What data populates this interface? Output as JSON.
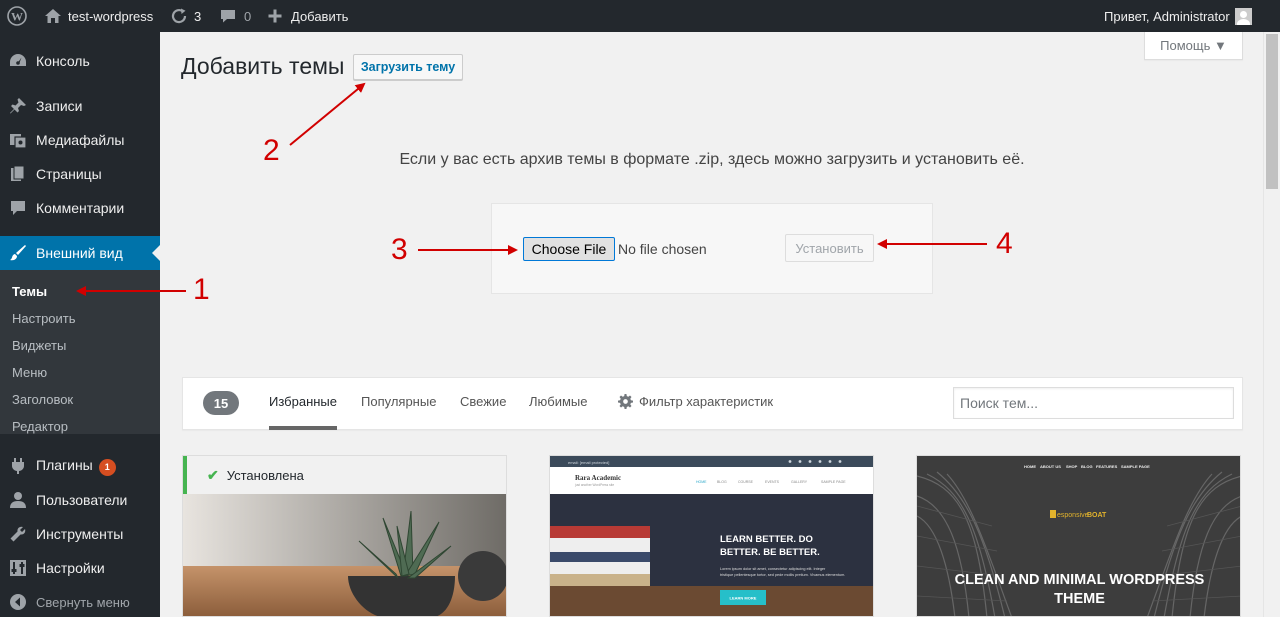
{
  "adminbar": {
    "site_name": "test-wordpress",
    "updates_count": "3",
    "comments_count": "0",
    "new_label": "Добавить",
    "greeting": "Привет, Administrator"
  },
  "sidebar": {
    "items": [
      {
        "label": "Консоль",
        "icon": "dashboard-icon"
      },
      {
        "label": "Записи",
        "icon": "pushpin-icon"
      },
      {
        "label": "Медиафайлы",
        "icon": "media-icon"
      },
      {
        "label": "Страницы",
        "icon": "page-icon"
      },
      {
        "label": "Комментарии",
        "icon": "comment-icon"
      },
      {
        "label": "Внешний вид",
        "icon": "brush-icon"
      },
      {
        "label": "Плагины",
        "icon": "plugin-icon",
        "badge": "1"
      },
      {
        "label": "Пользователи",
        "icon": "users-icon"
      },
      {
        "label": "Инструменты",
        "icon": "wrench-icon"
      },
      {
        "label": "Настройки",
        "icon": "settings-icon"
      },
      {
        "label": "Свернуть меню",
        "icon": "collapse-icon"
      }
    ],
    "submenu": [
      "Темы",
      "Настроить",
      "Виджеты",
      "Меню",
      "Заголовок",
      "Редактор"
    ]
  },
  "header": {
    "help_label": "Помощь ▼",
    "title": "Добавить темы",
    "upload_button": "Загрузить тему"
  },
  "upload": {
    "description": "Если у вас есть архив темы в формате .zip, здесь можно загрузить и установить её.",
    "file_button": "Choose File",
    "file_status": "No file chosen",
    "install_button": "Установить"
  },
  "filter": {
    "count": "15",
    "tabs": [
      "Избранные",
      "Популярные",
      "Свежие",
      "Любимые"
    ],
    "feature_filter": "Фильтр характеристик",
    "search_placeholder": "Поиск тем..."
  },
  "themes": [
    {
      "installed_label": "Установлена"
    },
    {
      "email": "email: [email protected]",
      "name": "Rara Academic",
      "tagline": "just another WordPress site",
      "nav": [
        "HOME",
        "BLOG",
        "COURSE",
        "EVENTS",
        "GALLERY",
        "SAMPLE PAGE"
      ],
      "headline_1": "LEARN BETTER. DO",
      "headline_2": "BETTER. BE BETTER.",
      "body": "Lorem ipsum dolor sit amet, consectetur adipiscing elit. Integer tristique pellentesque tortor, sed pede mollis pretium. Vivamus elementum.",
      "cta": "LEARN MORE"
    },
    {
      "nav": [
        "HOME",
        "ABOUT US",
        "SHOP",
        "BLOG",
        "FEATURES",
        "SAMPLE PAGE"
      ],
      "logo_prefix": "esponsive",
      "logo_bold": "BOAT",
      "title_1": "CLEAN AND MINIMAL WORDPRESS",
      "title_2": "THEME"
    }
  ],
  "annotations": [
    "1",
    "2",
    "3",
    "4"
  ],
  "colors": {
    "adminbar": "#23282d",
    "accent": "#0073aa",
    "installed": "#46b450",
    "badge": "#d54e21",
    "annotation": "#d10000"
  }
}
